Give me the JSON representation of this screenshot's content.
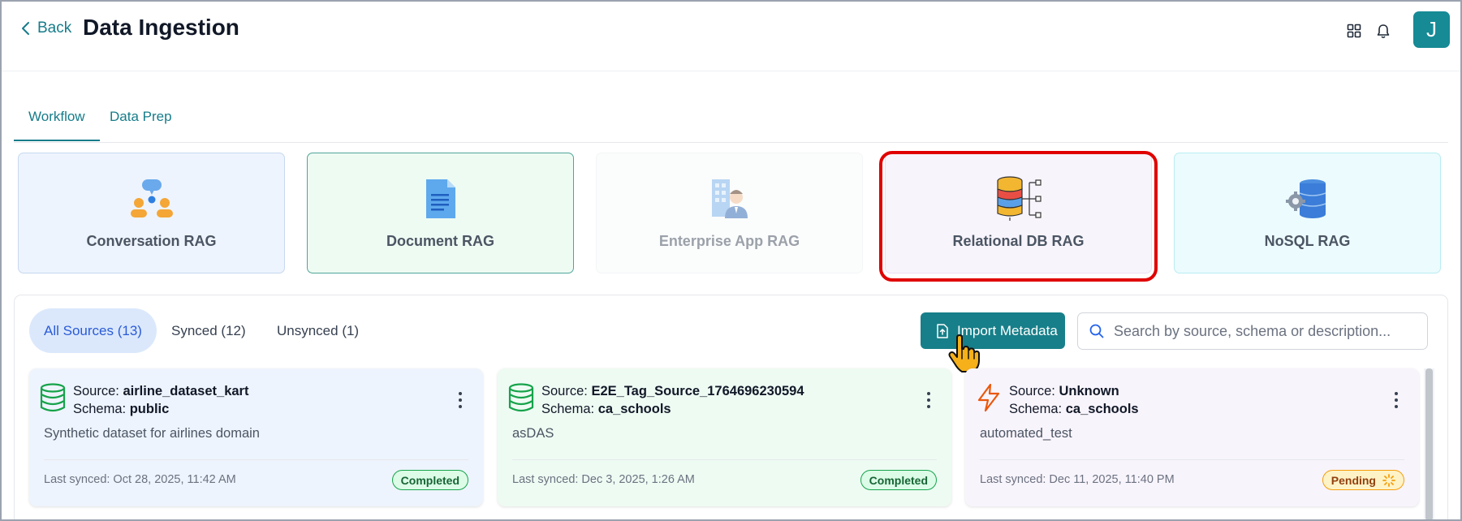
{
  "header": {
    "back_label": "Back",
    "title": "Data Ingestion",
    "avatar_initial": "J"
  },
  "tabs": [
    {
      "label": "Workflow",
      "active": true
    },
    {
      "label": "Data Prep",
      "active": false
    }
  ],
  "rag_types": [
    {
      "label": "Conversation RAG",
      "icon": "people-chat-icon",
      "bg": "#eef4fd",
      "border": "#c6d8ef"
    },
    {
      "label": "Document RAG",
      "icon": "document-icon",
      "bg": "#eefbf3",
      "border": "#4fa59a"
    },
    {
      "label": "Enterprise App RAG",
      "icon": "enterprise-person-icon",
      "bg": "#f9fafb",
      "border": "#eceef1"
    },
    {
      "label": "Relational DB RAG",
      "icon": "relational-db-icon",
      "bg": "#f8f4fc",
      "border": "#ecdff4"
    },
    {
      "label": "NoSQL RAG",
      "icon": "nosql-db-icon",
      "bg": "#ecfbfd",
      "border": "#b9edf3"
    }
  ],
  "filters": {
    "all": "All Sources (13)",
    "synced": "Synced (12)",
    "unsynced": "Unsynced (1)"
  },
  "import_label": "Import Metadata",
  "search": {
    "placeholder": "Search by source, schema or description..."
  },
  "sources": [
    {
      "source_label": "Source:",
      "source": "airline_dataset_kart",
      "schema_label": "Schema:",
      "schema": "public",
      "description": "Synthetic dataset for airlines domain",
      "last_synced": "Last synced: Oct 28, 2025, 11:42 AM",
      "status": "Completed",
      "icon": "database-icon",
      "bg": "#eef4fd"
    },
    {
      "source_label": "Source:",
      "source": "E2E_Tag_Source_1764696230594",
      "schema_label": "Schema:",
      "schema": "ca_schools",
      "description": "asDAS",
      "last_synced": "Last synced: Dec 3, 2025, 1:26 AM",
      "status": "Completed",
      "icon": "database-icon",
      "bg": "#eefbf3"
    },
    {
      "source_label": "Source:",
      "source": "Unknown",
      "schema_label": "Schema:",
      "schema": "ca_schools",
      "description": "automated_test",
      "last_synced": "Last synced: Dec 11, 2025, 11:40 PM",
      "status": "Pending",
      "icon": "lightning-icon",
      "bg": "#f8f4fc"
    }
  ],
  "colors": {
    "accent": "#167c8a",
    "highlight": "#e00000",
    "completed": "#16a34a",
    "pending": "#f59e0b"
  }
}
